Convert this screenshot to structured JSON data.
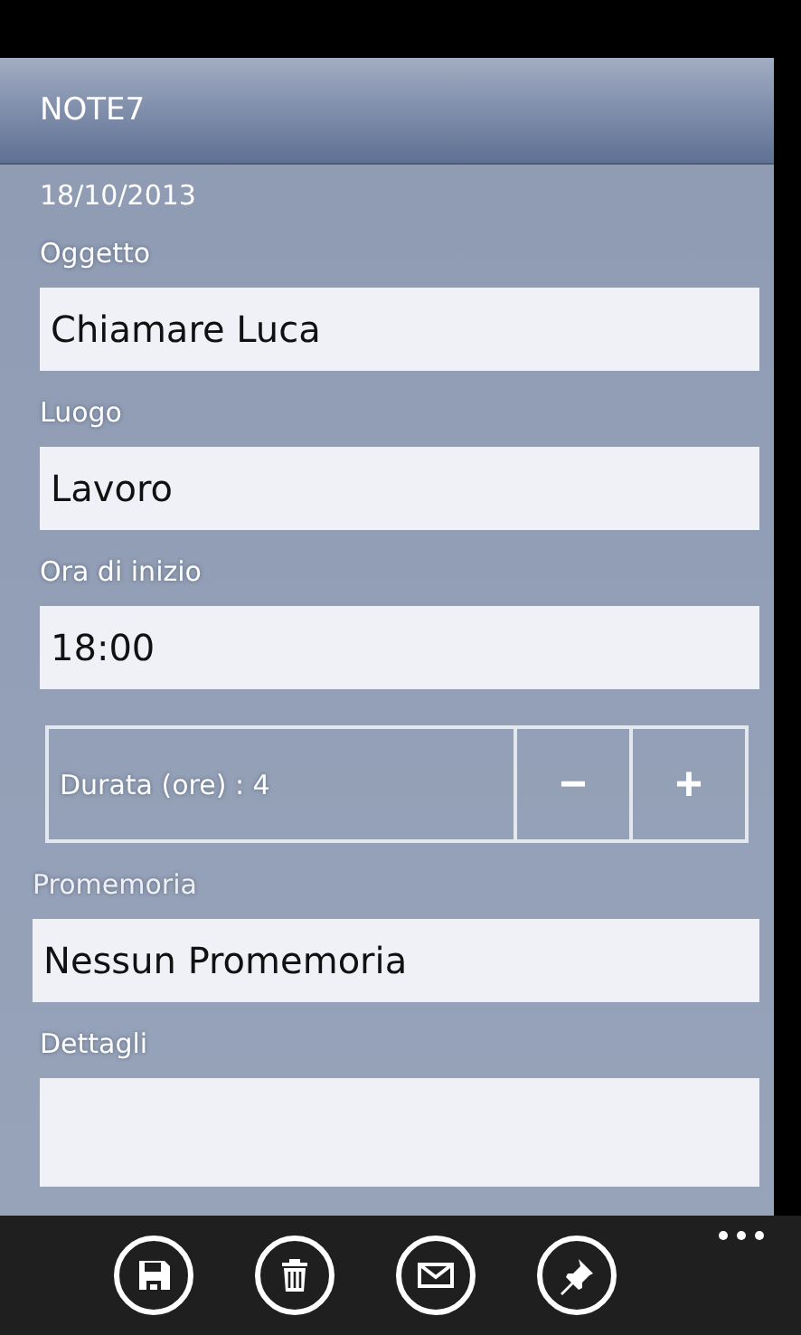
{
  "header": {
    "title": "NOTE7"
  },
  "date": "18/10/2013",
  "fields": [
    {
      "label": "Oggetto",
      "value": "Chiamare Luca"
    },
    {
      "label": "Luogo",
      "value": "Lavoro"
    },
    {
      "label": "Ora di inizio",
      "value": "18:00"
    }
  ],
  "duration": {
    "label": "Durata (ore) : 4",
    "minus": "−",
    "plus": "+"
  },
  "reminder": {
    "label": "Promemoria",
    "value": "Nessun Promemoria",
    "disabled": true
  },
  "details": {
    "label": "Dettagli"
  },
  "app_bar": {
    "buttons": [
      {
        "kind": "save"
      },
      {
        "kind": "delete"
      },
      {
        "kind": "mail"
      },
      {
        "kind": "pin"
      }
    ]
  }
}
